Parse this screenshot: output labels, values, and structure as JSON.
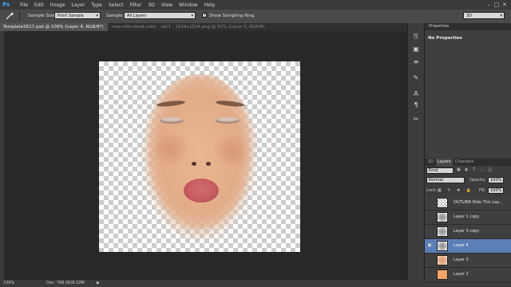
{
  "app": {
    "logo": "Ps"
  },
  "menu": [
    "File",
    "Edit",
    "Image",
    "Layer",
    "Type",
    "Select",
    "Filter",
    "3D",
    "View",
    "Window",
    "Help"
  ],
  "window_controls": [
    "–",
    "□",
    "✕"
  ],
  "options": {
    "tool_icon": "eyedropper-icon",
    "sample_size_label": "Sample Size:",
    "sample_size_value": "Point Sample",
    "sample_label": "Sample:",
    "sample_value": "All Layers",
    "show_ring_label": "Show Sampling Ring",
    "show_ring_checked": true,
    "workspace_value": "3D"
  },
  "tabs": [
    {
      "label": "Template2K17.psd @ 100% (Layer 4, RGB/8*) *",
      "close": "×"
    },
    {
      "label": "new-ellie-head-color - dat1 - 1024x1024.png @ 50% (Layer 0, RGB/8) *",
      "close": "×"
    }
  ],
  "status": {
    "zoom": "100%",
    "doc": "Doc: 768.0K/8.10M",
    "arrow": "▶"
  },
  "properties": {
    "tab": "Properties",
    "empty_text": "No Properties"
  },
  "layers_panel": {
    "tabs": [
      "3D",
      "Layers",
      "Channels"
    ],
    "filter_kind": "Kind",
    "blend_mode": "Normal",
    "opacity_label": "Opacity:",
    "opacity_value": "100%",
    "lock_label": "Lock:",
    "fill_label": "Fill:",
    "fill_value": "100%",
    "layers": [
      {
        "name": "OUTLINE-Hide This Lay...",
        "visible": false,
        "selected": false,
        "thumb": "checker"
      },
      {
        "name": "Layer 1 copy",
        "visible": false,
        "selected": false,
        "thumb": "face-gray"
      },
      {
        "name": "Layer 3 copy",
        "visible": false,
        "selected": false,
        "thumb": "face-gray"
      },
      {
        "name": "Layer 4",
        "visible": true,
        "selected": true,
        "thumb": "face-gray"
      },
      {
        "name": "Layer 3",
        "visible": false,
        "selected": false,
        "thumb": "face-color"
      },
      {
        "name": "Layer 2",
        "visible": false,
        "selected": false,
        "thumb": "orange"
      }
    ]
  },
  "colors": {
    "accent": "#5b7fb6",
    "ps_blue": "#3fa7ff"
  }
}
